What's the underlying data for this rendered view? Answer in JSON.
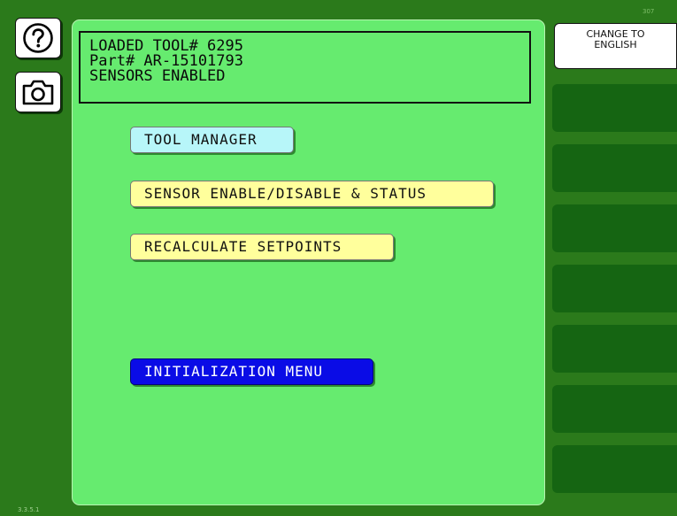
{
  "screen_id": "307",
  "version": "3.3.5.1",
  "status": {
    "line1": "LOADED TOOL# 6295",
    "line2": "Part# AR-15101793",
    "line3": "SENSORS ENABLED"
  },
  "menu": {
    "tool_manager": "TOOL MANAGER",
    "sensor_enable": "SENSOR ENABLE/DISABLE & STATUS",
    "recalculate": "RECALCULATE SETPOINTS",
    "initialization": "INITIALIZATION MENU"
  },
  "language_button": {
    "line1": "CHANGE TO",
    "line2": "ENGLISH"
  },
  "icons": {
    "help": "help-icon",
    "camera": "camera-icon"
  },
  "colors": {
    "background": "#2b7a1b",
    "panel": "#66eb6f",
    "tool_manager_button": "#b7f6f9",
    "action_button": "#ffff9c",
    "init_button": "#0a0ce6",
    "empty_slot": "#156512"
  }
}
